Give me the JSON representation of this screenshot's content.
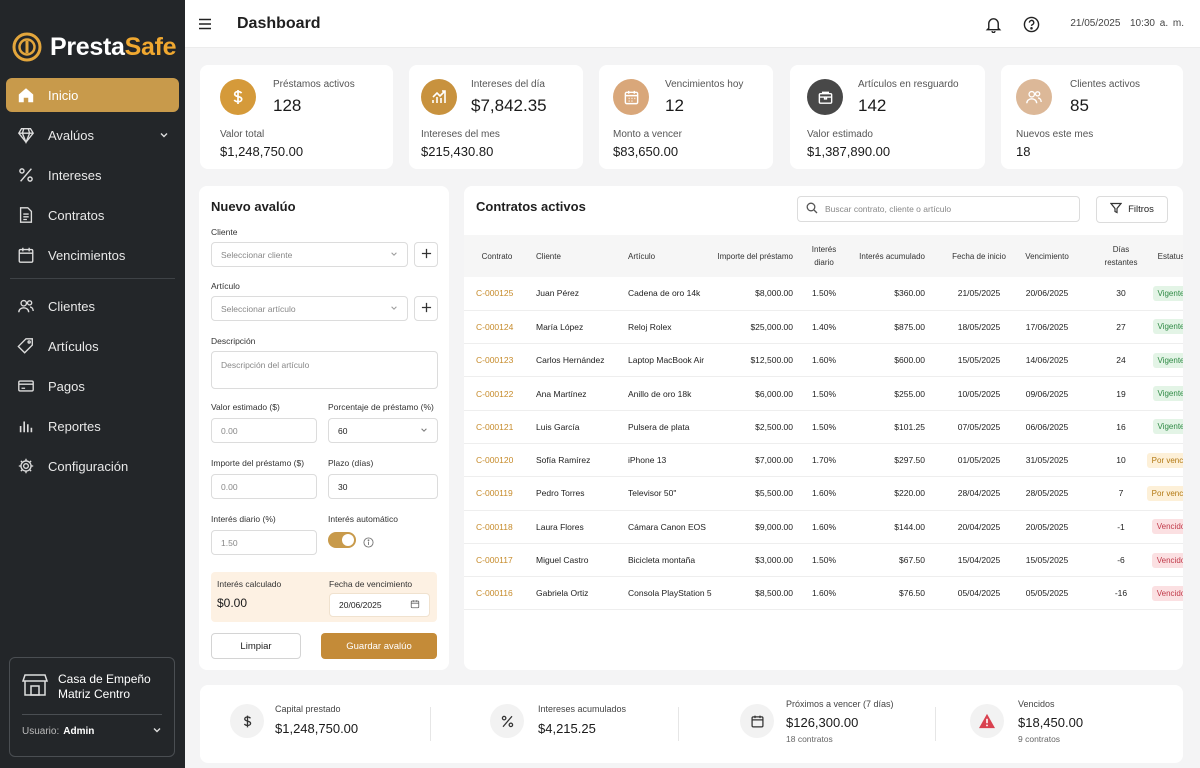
{
  "brand": {
    "name_part1": "Presta",
    "name_part2": "Safe",
    "accent": "#c89a4b"
  },
  "sidebar": {
    "items": [
      {
        "label": "Inicio",
        "icon": "home-icon",
        "active": true
      },
      {
        "label": "Avalúos",
        "icon": "diamond-icon",
        "has_submenu": true
      },
      {
        "label": "Intereses",
        "icon": "percent-icon"
      },
      {
        "label": "Contratos",
        "icon": "document-icon"
      },
      {
        "label": "Vencimientos",
        "icon": "calendar-icon"
      },
      {
        "label": "Clientes",
        "icon": "users-icon"
      },
      {
        "label": "Artículos",
        "icon": "tag-icon"
      },
      {
        "label": "Pagos",
        "icon": "credit-card-icon"
      },
      {
        "label": "Reportes",
        "icon": "bar-chart-icon"
      },
      {
        "label": "Configuración",
        "icon": "gear-icon"
      }
    ],
    "store": {
      "line1": "Casa de Empeño",
      "line2": "Matriz Centro"
    },
    "user_label": "Usuario:",
    "user_name": "Admin"
  },
  "header": {
    "title": "Dashboard",
    "date": "21/05/2025",
    "time": "10:30 a. m."
  },
  "stats": [
    {
      "label": "Préstamos activos",
      "value": "128",
      "sub_label": "Valor total",
      "sub_value": "$1,248,750.00",
      "icon": "dollar-icon",
      "color": "#d59a3a"
    },
    {
      "label": "Intereses del día",
      "value": "$7,842.35",
      "sub_label": "Intereses del mes",
      "sub_value": "$215,430.80",
      "icon": "trend-chart-icon",
      "color": "#c8923e"
    },
    {
      "label": "Vencimientos hoy",
      "value": "12",
      "sub_label": "Monto a vencer",
      "sub_value": "$83,650.00",
      "icon": "calendar-icon",
      "color": "#d9a77a"
    },
    {
      "label": "Artículos en resguardo",
      "value": "142",
      "sub_label": "Valor estimado",
      "sub_value": "$1,387,890.00",
      "icon": "box-icon",
      "color": "#484848"
    },
    {
      "label": "Clientes activos",
      "value": "85",
      "sub_label": "Nuevos este mes",
      "sub_value": "18",
      "icon": "users-icon",
      "color": "#dcb898"
    }
  ],
  "form": {
    "title": "Nuevo avalúo",
    "cliente_label": "Cliente",
    "cliente_placeholder": "Seleccionar cliente",
    "articulo_label": "Artículo",
    "articulo_placeholder": "Seleccionar artículo",
    "descripcion_label": "Descripción",
    "descripcion_placeholder": "Descripción del artículo",
    "valor_label": "Valor estimado ($)",
    "valor_value": "0.00",
    "porcentaje_label": "Porcentaje de préstamo (%)",
    "porcentaje_value": "60",
    "importe_label": "Importe del préstamo ($)",
    "importe_value": "0.00",
    "plazo_label": "Plazo (días)",
    "plazo_value": "30",
    "interes_label": "Interés diario (%)",
    "interes_value": "1.50",
    "auto_label": "Interés automático",
    "auto_on": true,
    "calc_label": "Interés calculado",
    "calc_value": "$0.00",
    "venc_label": "Fecha de vencimiento",
    "venc_value": "20/06/2025",
    "clear_label": "Limpiar",
    "save_label": "Guardar avalúo"
  },
  "contracts": {
    "title": "Contratos activos",
    "search_placeholder": "Buscar contrato, cliente o artículo",
    "filter_label": "Filtros",
    "headers": [
      "Contrato",
      "Cliente",
      "Artículo",
      "Importe del préstamo",
      "Interés diario",
      "Interés acumulado",
      "Fecha de inicio",
      "Vencimiento",
      "Días restantes",
      "Estatus"
    ],
    "rows": [
      [
        "C-000125",
        "Juan Pérez",
        "Cadena de oro 14k",
        "$8,000.00",
        "1.50%",
        "$360.00",
        "21/05/2025",
        "20/06/2025",
        "30",
        "Vigente"
      ],
      [
        "C-000124",
        "María López",
        "Reloj Rolex",
        "$25,000.00",
        "1.40%",
        "$875.00",
        "18/05/2025",
        "17/06/2025",
        "27",
        "Vigente"
      ],
      [
        "C-000123",
        "Carlos Hernández",
        "Laptop MacBook Air",
        "$12,500.00",
        "1.60%",
        "$600.00",
        "15/05/2025",
        "14/06/2025",
        "24",
        "Vigente"
      ],
      [
        "C-000122",
        "Ana Martínez",
        "Anillo de oro 18k",
        "$6,000.00",
        "1.50%",
        "$255.00",
        "10/05/2025",
        "09/06/2025",
        "19",
        "Vigente"
      ],
      [
        "C-000121",
        "Luis García",
        "Pulsera de plata",
        "$2,500.00",
        "1.50%",
        "$101.25",
        "07/05/2025",
        "06/06/2025",
        "16",
        "Vigente"
      ],
      [
        "C-000120",
        "Sofía Ramírez",
        "iPhone 13",
        "$7,000.00",
        "1.70%",
        "$297.50",
        "01/05/2025",
        "31/05/2025",
        "10",
        "Por vencer"
      ],
      [
        "C-000119",
        "Pedro Torres",
        "Televisor 50\"",
        "$5,500.00",
        "1.60%",
        "$220.00",
        "28/04/2025",
        "28/05/2025",
        "7",
        "Por vencer"
      ],
      [
        "C-000118",
        "Laura Flores",
        "Cámara Canon EOS",
        "$9,000.00",
        "1.60%",
        "$144.00",
        "20/04/2025",
        "20/05/2025",
        "-1",
        "Vencido"
      ],
      [
        "C-000117",
        "Miguel Castro",
        "Bicicleta montaña",
        "$3,000.00",
        "1.50%",
        "$67.50",
        "15/04/2025",
        "15/05/2025",
        "-6",
        "Vencido"
      ],
      [
        "C-000116",
        "Gabriela Ortiz",
        "Consola PlayStation 5",
        "$8,500.00",
        "1.60%",
        "$76.50",
        "05/04/2025",
        "05/05/2025",
        "-16",
        "Vencido"
      ]
    ]
  },
  "summary": [
    {
      "label": "Capital prestado",
      "value": "$1,248,750.00",
      "sub": "",
      "icon": "dollar-icon"
    },
    {
      "label": "Intereses acumulados",
      "value": "$4,215.25",
      "sub": "",
      "icon": "percent-icon"
    },
    {
      "label": "Próximos a vencer (7 días)",
      "value": "$126,300.00",
      "sub": "18 contratos",
      "icon": "calendar-icon"
    },
    {
      "label": "Vencidos",
      "value": "$18,450.00",
      "sub": "9 contratos",
      "icon": "warning-icon"
    }
  ]
}
